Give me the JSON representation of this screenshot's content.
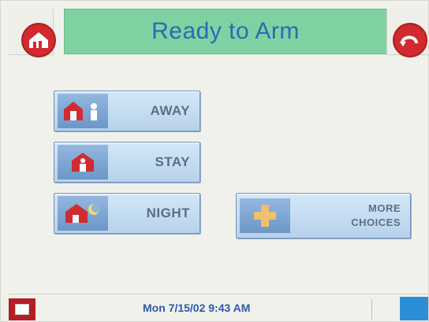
{
  "header": {
    "title": "Ready to Arm"
  },
  "buttons": {
    "away": "AWAY",
    "stay": "STAY",
    "night": "NIGHT",
    "more_line1": "MORE",
    "more_line2": "CHOICES"
  },
  "footer": {
    "datetime": "Mon 7/15/02  9:43 AM"
  },
  "colors": {
    "title_bg": "#7ed2a2",
    "title_text": "#2c69b6",
    "button_bg": "#c6dff4",
    "accent_red": "#d22a2e"
  }
}
